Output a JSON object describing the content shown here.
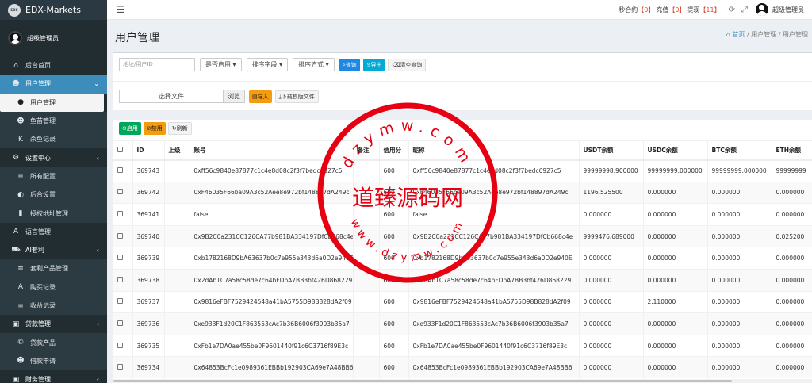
{
  "app": {
    "name": "EDX-Markets",
    "logo_text": "EDX"
  },
  "user": {
    "name": "超级管理员"
  },
  "sidebar": {
    "items": [
      {
        "label": "后台首页",
        "icon": "home-icon",
        "level": "top"
      },
      {
        "label": "用户管理",
        "icon": "users-icon",
        "level": "group-active"
      },
      {
        "label": "用户管理",
        "icon": "user-icon",
        "level": "current"
      },
      {
        "label": "鱼苗管理",
        "icon": "users-icon",
        "level": "sub"
      },
      {
        "label": "杀鱼记录",
        "icon": "k-icon",
        "level": "sub"
      },
      {
        "label": "设置中心",
        "icon": "gears-icon",
        "level": "group"
      },
      {
        "label": "所有配置",
        "icon": "list-icon",
        "level": "sub"
      },
      {
        "label": "后台设置",
        "icon": "adjust-icon",
        "level": "sub"
      },
      {
        "label": "授权地址管理",
        "icon": "book-icon",
        "level": "sub"
      },
      {
        "label": "语言管理",
        "icon": "language-icon",
        "level": "top"
      },
      {
        "label": "AI套利",
        "icon": "car-icon",
        "level": "group"
      },
      {
        "label": "套利产品管理",
        "icon": "list-icon",
        "level": "sub"
      },
      {
        "label": "购买记录",
        "icon": "font-icon",
        "level": "sub"
      },
      {
        "label": "收益记录",
        "icon": "list-icon",
        "level": "sub"
      },
      {
        "label": "贷款管理",
        "icon": "money-icon",
        "level": "group"
      },
      {
        "label": "贷款产品",
        "icon": "copyright-icon",
        "level": "sub"
      },
      {
        "label": "借款申请",
        "icon": "users-icon",
        "level": "sub"
      },
      {
        "label": "财务管理",
        "icon": "money-icon",
        "level": "group"
      }
    ]
  },
  "topbar": {
    "contract_label": "秒合约",
    "contract_count": "【0】",
    "recharge_label": "充值",
    "recharge_count": "【0】",
    "withdraw_label": "提现",
    "withdraw_count": "【11】",
    "user_name": "超级管理员"
  },
  "page": {
    "title": "用户管理"
  },
  "breadcrumb": {
    "home": "首页",
    "sep1": "/",
    "level1": "用户管理",
    "sep2": "/",
    "level2": "用户管理"
  },
  "filters": {
    "search_placeholder": "地址/用户ID",
    "enabled_select": "是否启用",
    "sort_field_select": "排序字段",
    "sort_order_select": "排序方式",
    "query_button": "查询",
    "export_button": "导出",
    "clear_button": "清空查询"
  },
  "import": {
    "file_label": "选择文件",
    "browse_label": "浏览",
    "import_button": "导入",
    "download_template_button": "下载模版文件"
  },
  "actions": {
    "enable_button": "启用",
    "disable_button": "禁用",
    "refresh_button": "刷新"
  },
  "table": {
    "columns": [
      "",
      "ID",
      "上级",
      "账号",
      "备注",
      "信用分",
      "昵称",
      "USDT余额",
      "USDC余额",
      "BTC余额",
      "ETH余额"
    ],
    "rows": [
      [
        "369743",
        "",
        "0xff56c9840e87877c1c4e8d08c2f3f7bedc6927c5",
        "",
        "600",
        "0xff56c9840e87877c1c4e8d08c2f3f7bedc6927c5",
        "99999998.900000",
        "99999999.000000",
        "99999999.000000",
        "99999999"
      ],
      [
        "369742",
        "",
        "0xF46035F66ba09A3c52Aee8e972bf148897dA249c",
        "",
        "600",
        "0xF46035F66ba09A3c52Aee8e972bf148897dA249c",
        "1196.525500",
        "0.000000",
        "0.000000",
        "0.000000"
      ],
      [
        "369741",
        "",
        "false",
        "",
        "600",
        "false",
        "0.000000",
        "0.000000",
        "0.000000",
        "0.000000"
      ],
      [
        "369740",
        "",
        "0x9B2C0a231CC126CA77b981BA334197DfCb668c4e",
        "",
        "600",
        "0x9B2C0a231CC126CA77b981BA334197DfCb668c4e",
        "9999476.689000",
        "0.000000",
        "0.000000",
        "0.025200"
      ],
      [
        "369739",
        "",
        "0xb1782168D9bA63637b0c7e955e343d6a0D2e940E",
        "",
        "600",
        "0xb1782168D9bA63637b0c7e955e343d6a0D2e940E",
        "0.000000",
        "0.000000",
        "0.000000",
        "0.000000"
      ],
      [
        "369738",
        "",
        "0x2dAb1C7a58c58de7c64bFDbA7BB3bf426D868229",
        "",
        "600",
        "0x2dAb1C7a58c58de7c64bFDbA7BB3bf426D868229",
        "0.000000",
        "0.000000",
        "0.000000",
        "0.000000"
      ],
      [
        "369737",
        "",
        "0x9816eFBF7529424548a41bA5755D98B828dA2f09",
        "",
        "600",
        "0x9816eFBF7529424548a41bA5755D98B828dA2f09",
        "0.000000",
        "2.110000",
        "0.000000",
        "0.000000"
      ],
      [
        "369736",
        "",
        "0xe933F1d20C1F863553cAc7b36B6006f3903b35a7",
        "",
        "600",
        "0xe933F1d20C1F863553cAc7b36B6006f3903b35a7",
        "0.000000",
        "0.000000",
        "0.000000",
        "0.000000"
      ],
      [
        "369735",
        "",
        "0xFb1e7DA0ae455be0F9601440f91c6C3716f89E3c",
        "",
        "600",
        "0xFb1e7DA0ae455be0F9601440f91c6C3716f89E3c",
        "0.000000",
        "0.000000",
        "0.000000",
        "0.000000"
      ],
      [
        "369734",
        "",
        "0x64853BcFc1e0989361EBBb192903CA69e7A48BB6",
        "",
        "600",
        "0x64853BcFc1e0989361EBBb192903CA69e7A48BB6",
        "0.000000",
        "0.000000",
        "0.000000",
        "0.000000"
      ]
    ]
  },
  "watermark": {
    "brand": "道臻源码网",
    "url_top": "dzymw.com",
    "url_bottom": "www.dzymw.com"
  },
  "colors": {
    "sidebar_bg": "#222d32",
    "accent": "#3c8dbc",
    "stamp": "#e60012"
  }
}
